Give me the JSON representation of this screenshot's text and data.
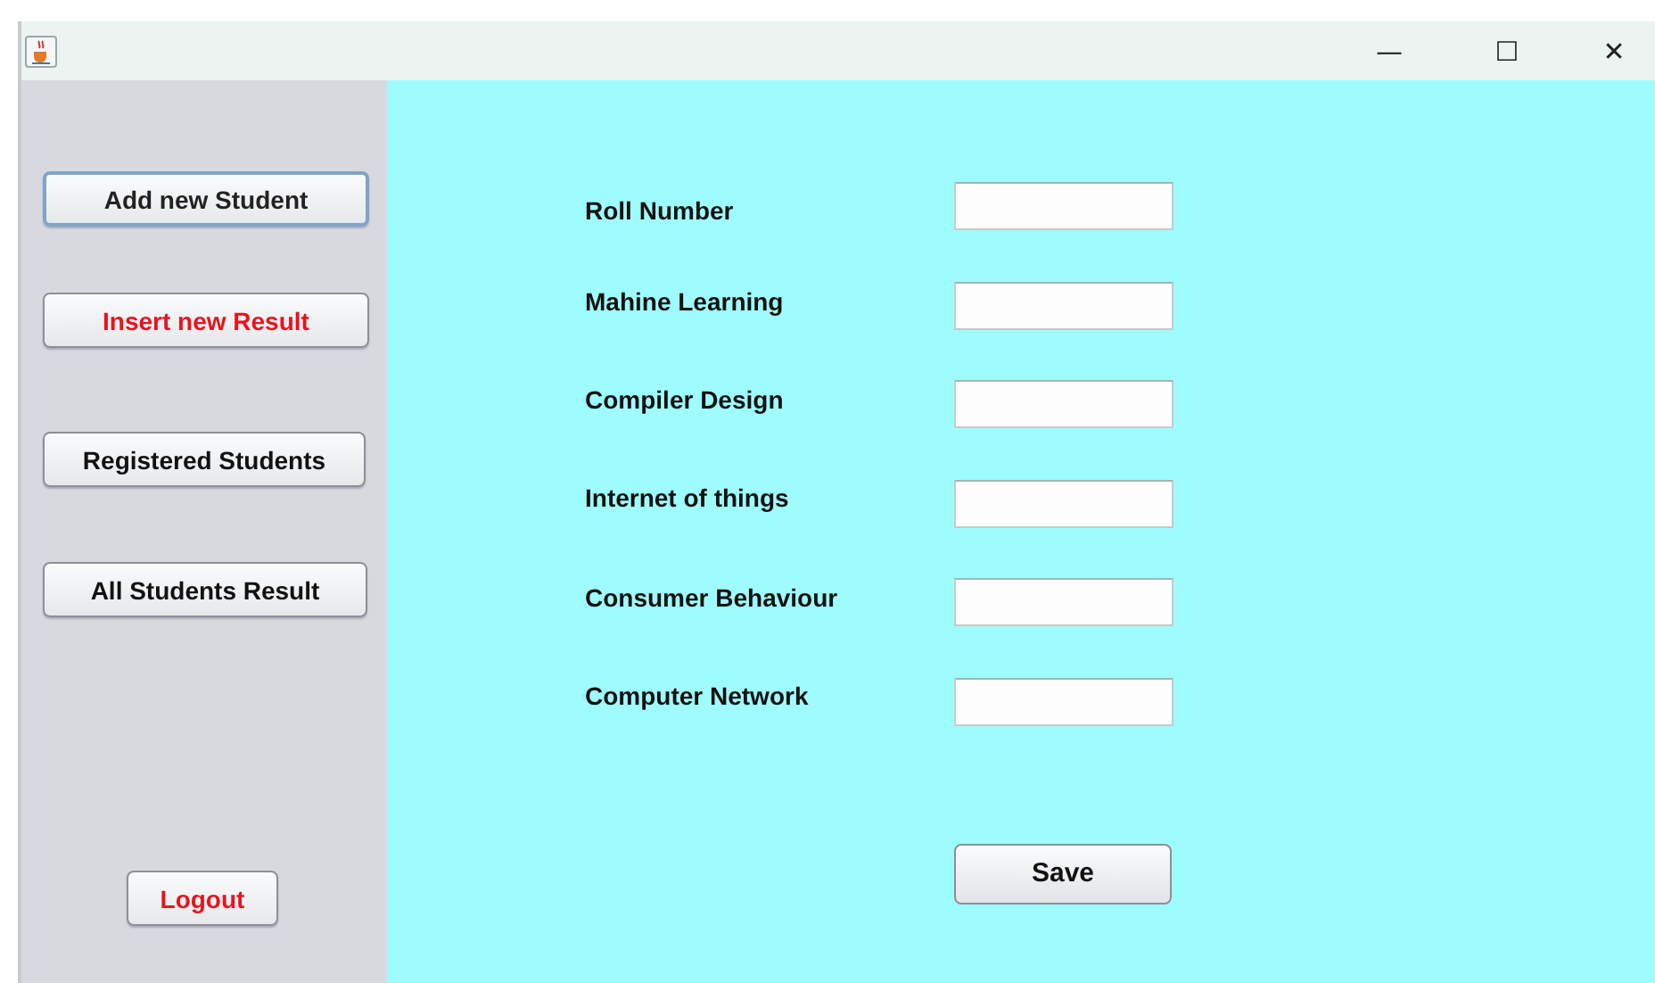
{
  "window": {
    "controls": [
      "—",
      "☐",
      "✕"
    ]
  },
  "sidebar": {
    "buttons": [
      {
        "label": "Add new Student",
        "color": "#222222",
        "focused": true
      },
      {
        "label": "Insert new Result",
        "color": "#e8141c",
        "focused": false
      },
      {
        "label": "Registered Students",
        "color": "#111111",
        "focused": false
      },
      {
        "label": "All Students Result",
        "color": "#111111",
        "focused": false
      },
      {
        "label": "Logout",
        "color": "#e8141c",
        "focused": false
      }
    ]
  },
  "form": {
    "fields": [
      {
        "label": "Roll Number"
      },
      {
        "label": "Mahine Learning"
      },
      {
        "label": "Compiler Design"
      },
      {
        "label": "Internet of things"
      },
      {
        "label": "Consumer Behaviour"
      },
      {
        "label": "Computer Network"
      }
    ],
    "save_button": "Save"
  }
}
